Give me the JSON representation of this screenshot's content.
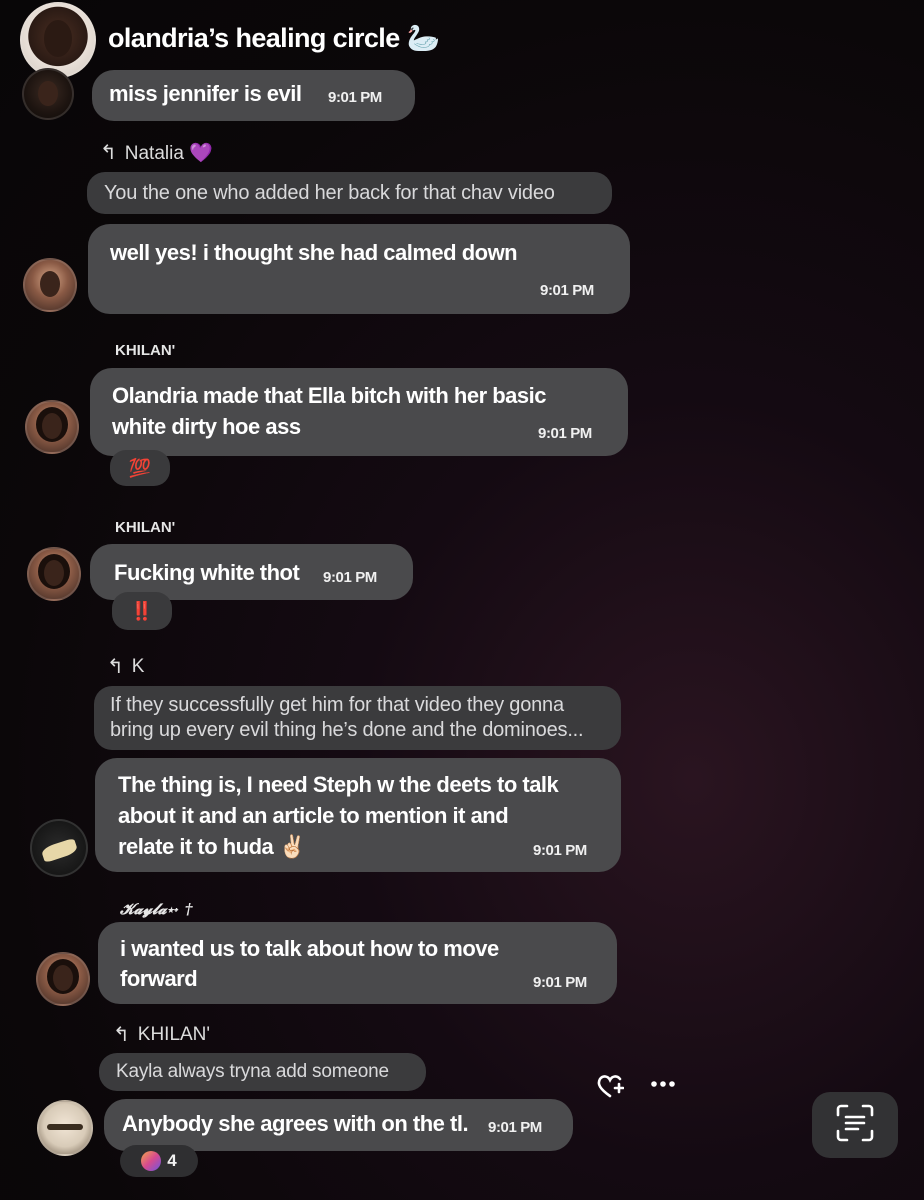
{
  "header": {
    "group_name": "olandria’s healing circle 🦢"
  },
  "messages": [
    {
      "text": "miss jennifer is evil",
      "time": "9:01 PM"
    },
    {
      "reply_to": "Natalia 💜",
      "quote": "You the one who added her back for that chav video",
      "text": "well yes! i thought she had calmed down",
      "time": "9:01 PM"
    },
    {
      "sender": "KHILAN'",
      "text_line1": "Olandria made that Ella bitch with her basic",
      "text_line2": "white dirty hoe ass",
      "time": "9:01 PM",
      "reaction": "💯"
    },
    {
      "sender": "KHILAN'",
      "text": "Fucking white thot",
      "time": "9:01 PM",
      "reaction": "‼️"
    },
    {
      "reply_to": "K",
      "quote_line1": "If they successfully get him for that video they gonna",
      "quote_line2": "bring up every evil thing he’s done and the dominoes...",
      "text_line1": "The thing is, I need Steph w the deets to talk",
      "text_line2": "about it and an article to mention it and",
      "text_line3": "relate it to huda ✌🏻",
      "time": "9:01 PM"
    },
    {
      "sender": "𝓚𝓪𝔂𝓵𝓪⋆˖ †",
      "text_line1": "i wanted us to talk about how to move",
      "text_line2": "forward",
      "time": "9:01 PM"
    },
    {
      "reply_to": "KHILAN'",
      "quote": "Kayla always tryna add someone",
      "text": "Anybody she agrees with on the tl.",
      "time": "9:01 PM",
      "reaction_count": "4"
    }
  ],
  "toolbar": {
    "react_icon": "heart-plus-icon",
    "more_icon": "ellipsis-icon",
    "scan_icon": "text-scan-icon"
  }
}
